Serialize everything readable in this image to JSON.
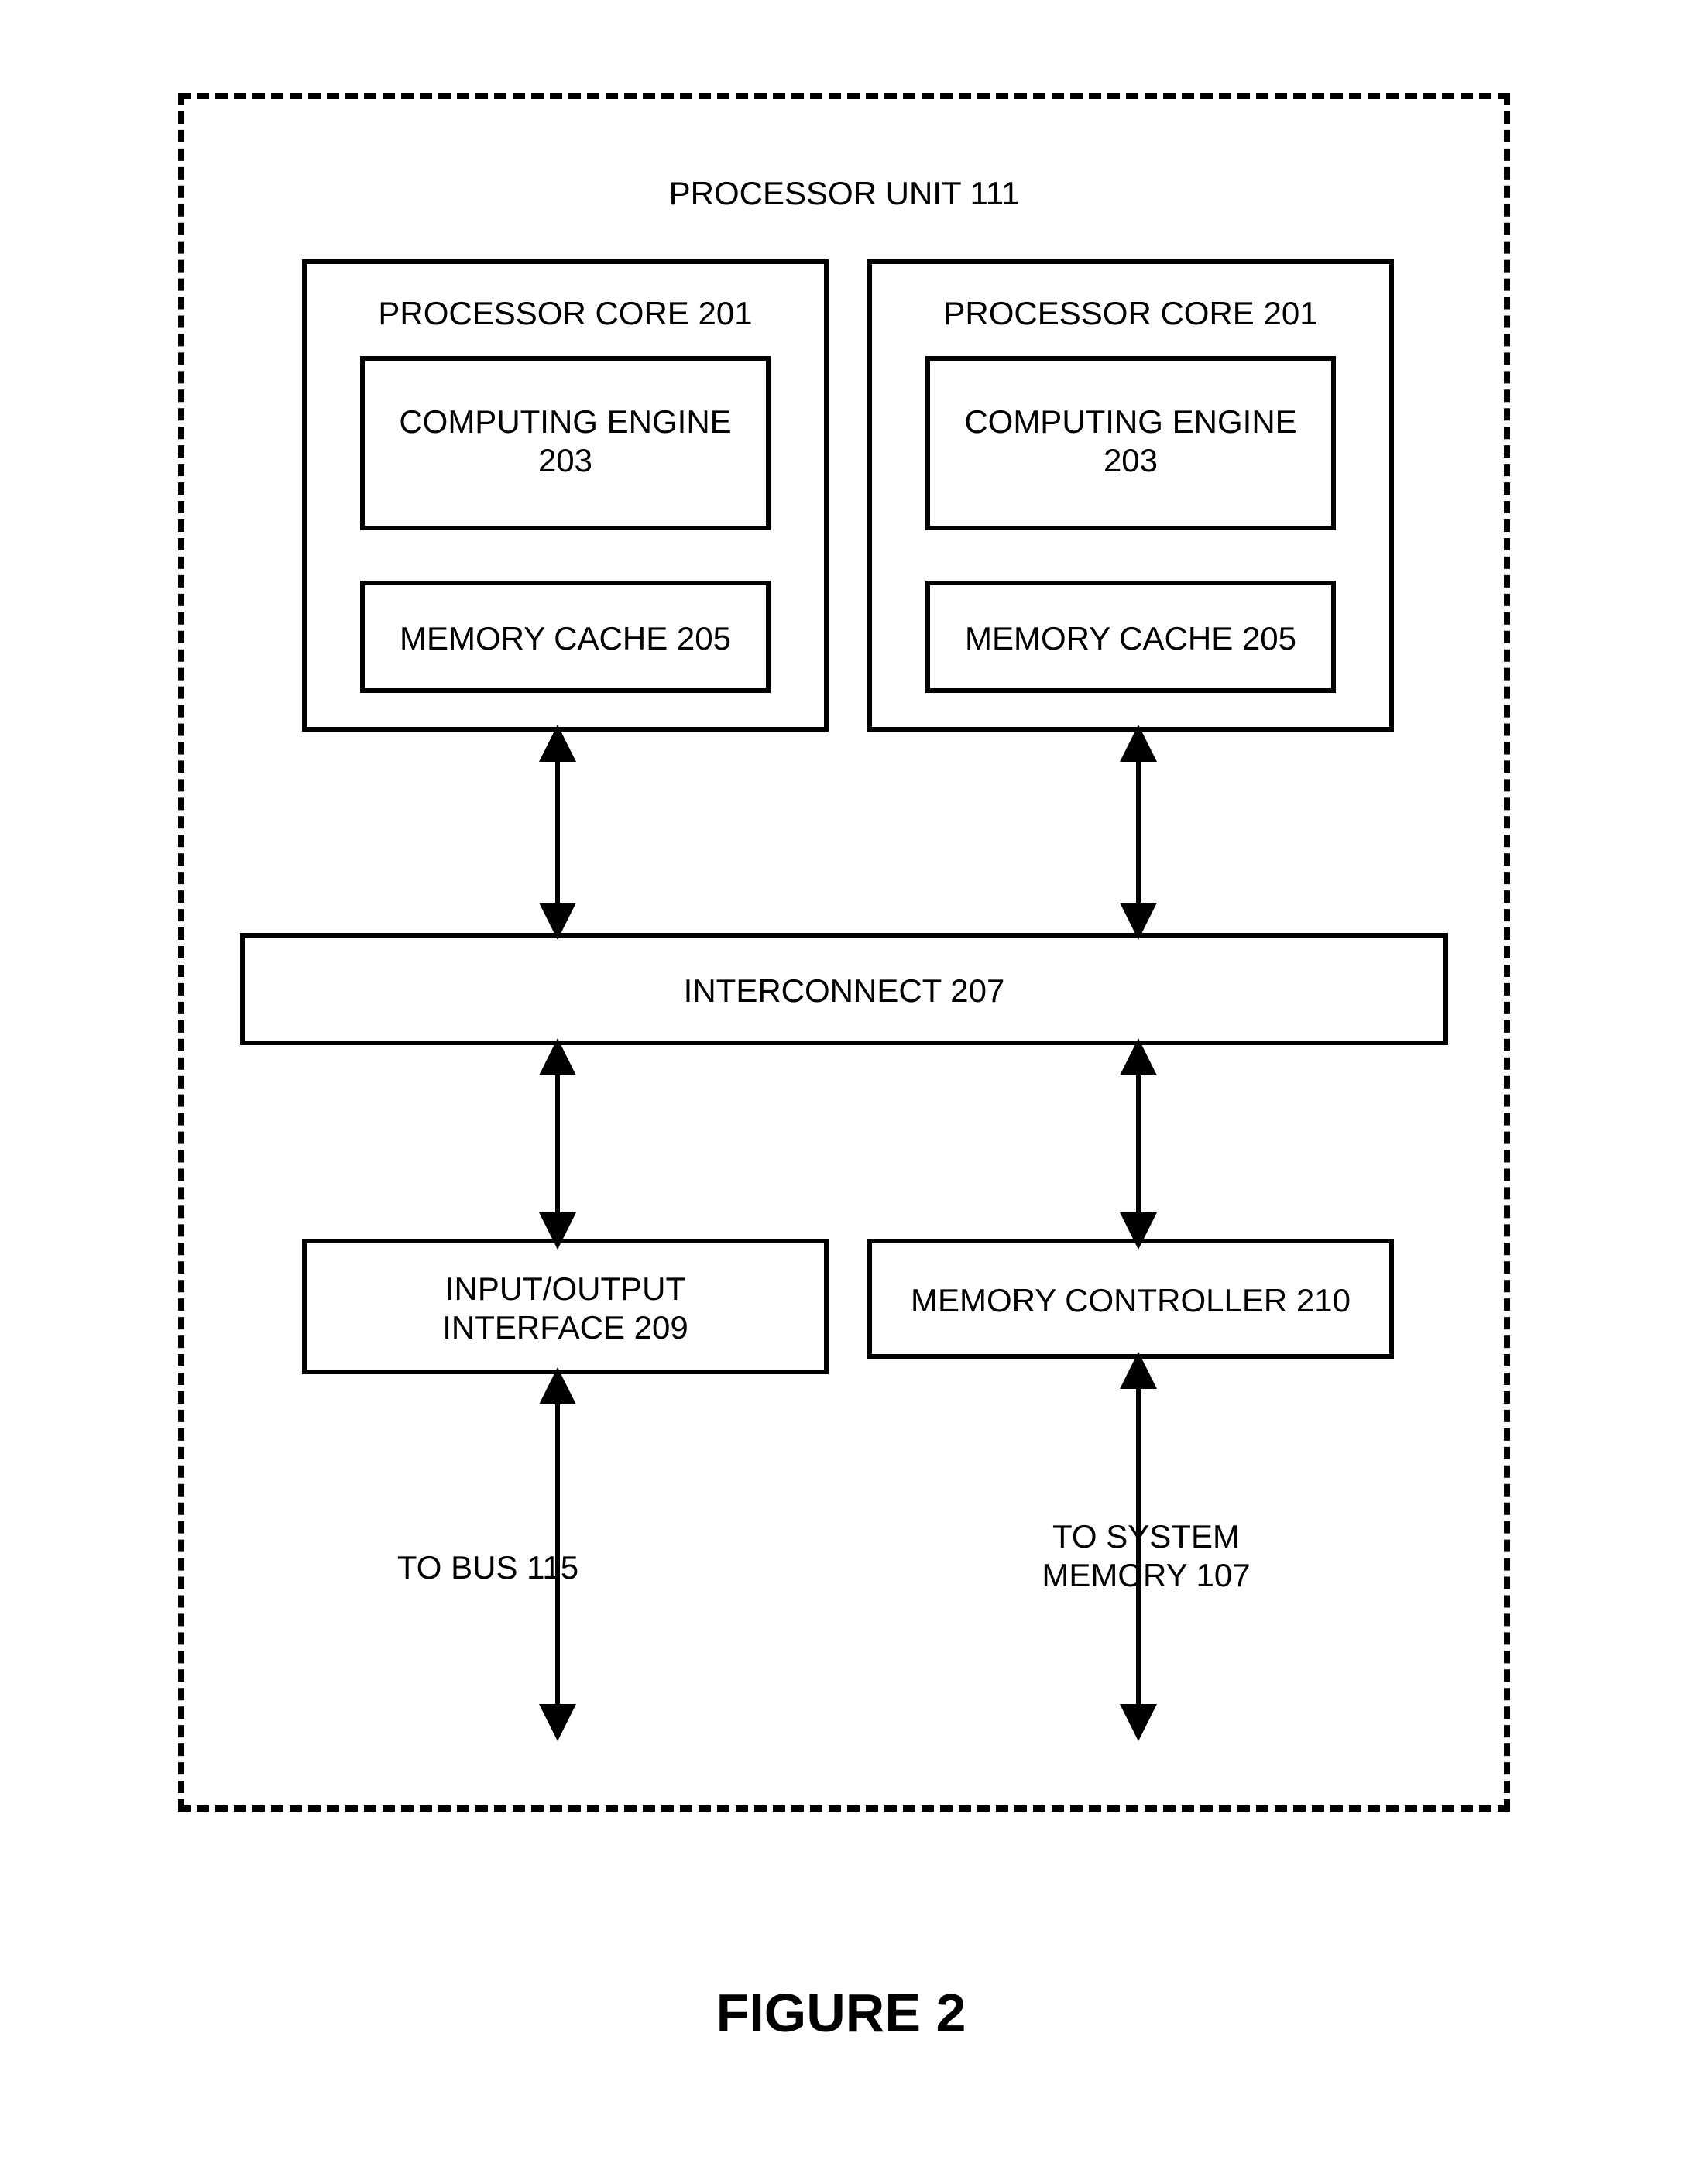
{
  "title": "PROCESSOR UNIT 111",
  "figure_caption": "FIGURE 2",
  "blocks": {
    "core_left": "PROCESSOR CORE 201",
    "core_right": "PROCESSOR CORE 201",
    "engine_left": "COMPUTING ENGINE\n203",
    "engine_right": "COMPUTING ENGINE\n203",
    "cache_left": "MEMORY CACHE 205",
    "cache_right": "MEMORY CACHE 205",
    "interconnect": "INTERCONNECT 207",
    "io_interface": "INPUT/OUTPUT\nINTERFACE 209",
    "mem_controller": "MEMORY CONTROLLER 210",
    "to_bus": "TO BUS 115",
    "to_sysmem": "TO SYSTEM\nMEMORY 107"
  }
}
